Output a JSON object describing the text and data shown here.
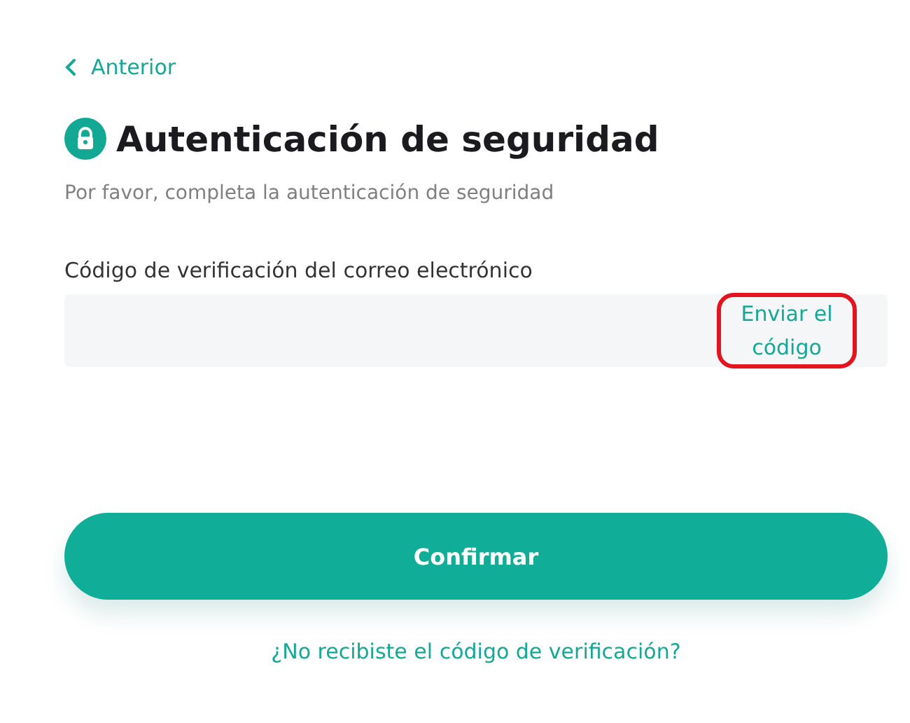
{
  "back_link": {
    "label": "Anterior"
  },
  "title": "Autenticación de seguridad",
  "subtitle": "Por favor, completa la autenticación de seguridad",
  "field": {
    "label": "Código de verificación del correo electrónico",
    "send_code": {
      "label": "Enviar el código",
      "highlighted": true
    }
  },
  "confirm_button": {
    "label": "Confirmar"
  },
  "help_link": {
    "label": "¿No recibiste el código de verificación?"
  }
}
